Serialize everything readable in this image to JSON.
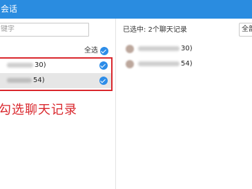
{
  "header": {
    "title": "会话"
  },
  "left_panel": {
    "search_placeholder": "键字",
    "select_all_label": "全选",
    "conversations": [
      {
        "label_suffix": "30)",
        "checked": true
      },
      {
        "label_suffix": "54)",
        "checked": true
      }
    ],
    "annotation": "勾选聊天记录"
  },
  "right_panel": {
    "selected_summary": "已选中: 2个聊天记录",
    "select_all_button": "全部",
    "selected_items": [
      {
        "label_suffix": "30)"
      },
      {
        "label_suffix": "54)"
      }
    ]
  },
  "colors": {
    "titlebar": "#2a8ce0",
    "check": "#2d8de8",
    "annotation": "#d9262c",
    "selected_row": "#e6e6e6"
  },
  "icons": {
    "check": "checkmark-circle-icon",
    "avatar": "avatar"
  }
}
